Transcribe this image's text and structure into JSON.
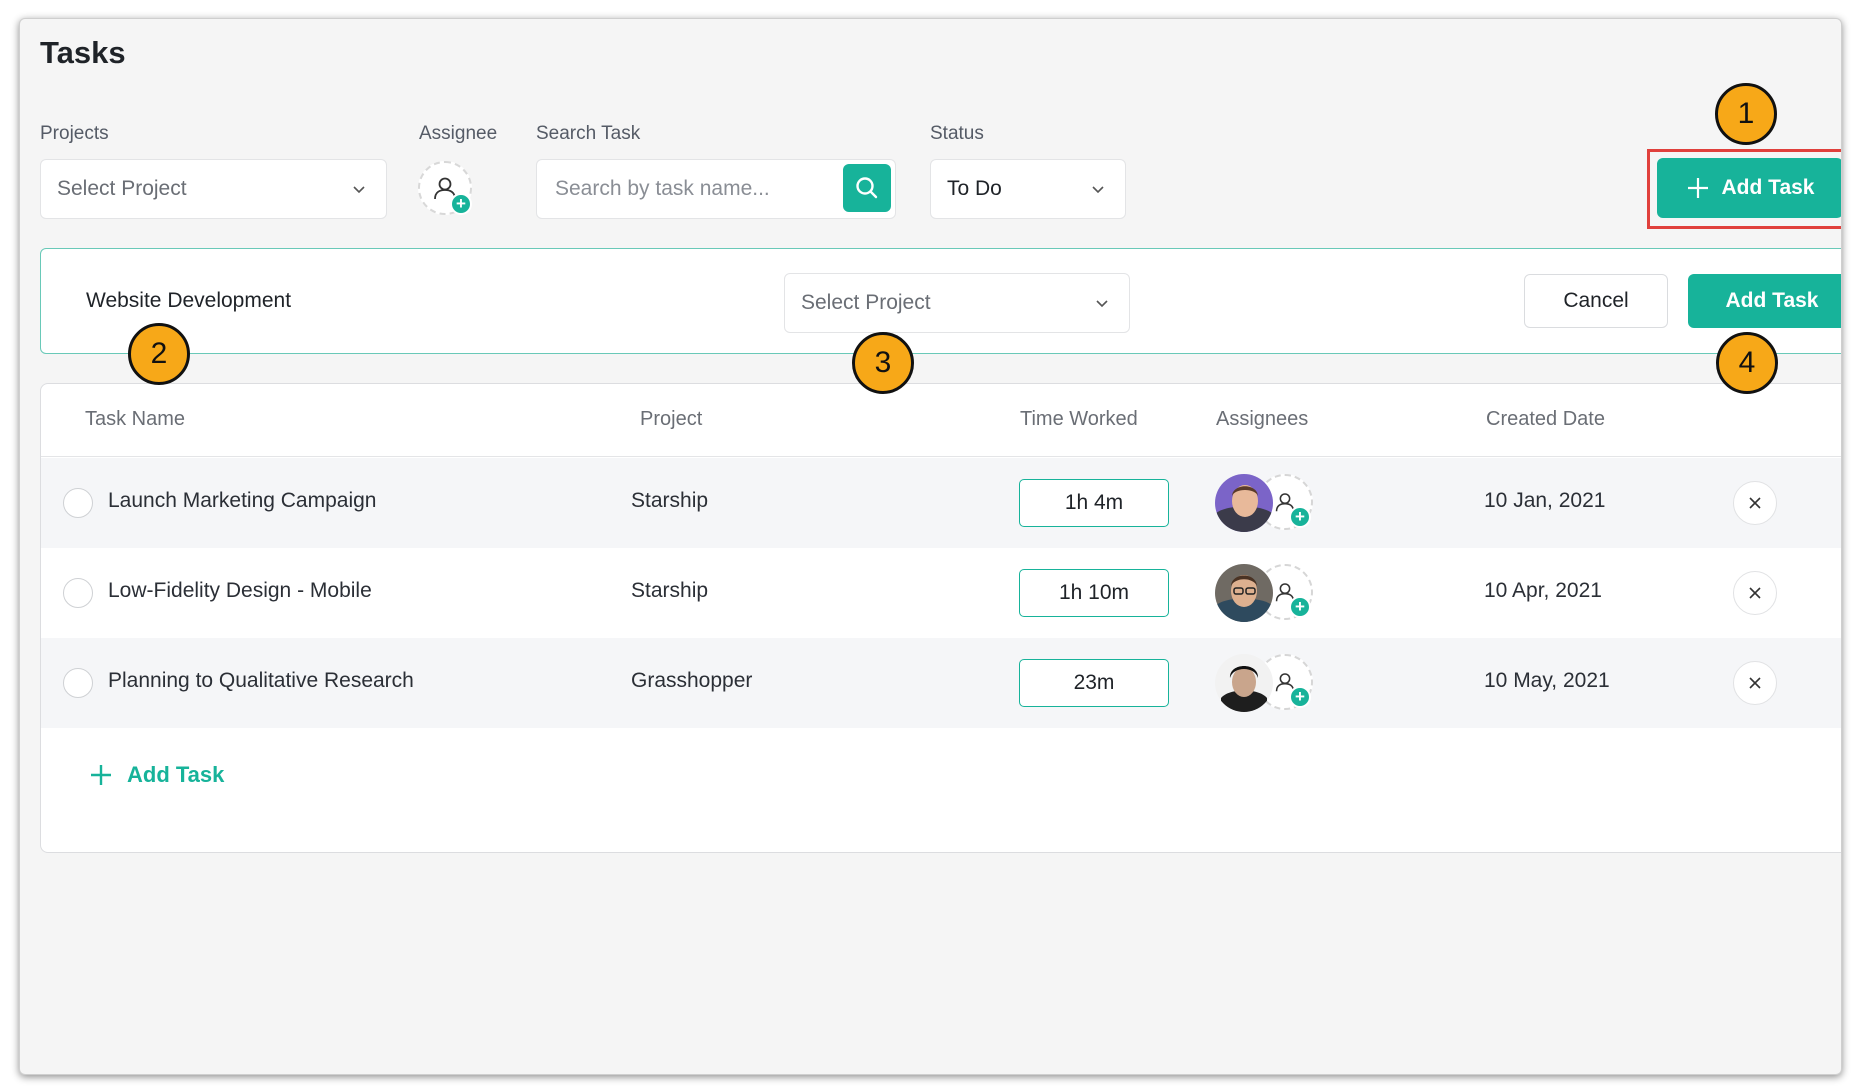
{
  "page": {
    "title": "Tasks"
  },
  "filters": {
    "projects_label": "Projects",
    "projects_placeholder": "Select Project",
    "assignee_label": "Assignee",
    "search_label": "Search Task",
    "search_placeholder": "Search by task name...",
    "status_label": "Status",
    "status_value": "To Do"
  },
  "header_actions": {
    "add_task_label": "Add Task"
  },
  "quick_add": {
    "task_name": "Website Development",
    "project_placeholder": "Select Project",
    "cancel_label": "Cancel",
    "add_label": "Add Task"
  },
  "callouts": [
    "1",
    "2",
    "3",
    "4"
  ],
  "table": {
    "headers": [
      "Task Name",
      "Project",
      "Time Worked",
      "Assignees",
      "Created Date"
    ],
    "rows": [
      {
        "task": "Launch Marketing Campaign",
        "project": "Starship",
        "time": "1h 4m",
        "date": "10 Jan, 2021"
      },
      {
        "task": "Low-Fidelity Design - Mobile",
        "project": "Starship",
        "time": "1h 10m",
        "date": "10 Apr, 2021"
      },
      {
        "task": "Planning to Qualitative Research",
        "project": "Grasshopper",
        "time": "23m",
        "date": "10 May, 2021"
      }
    ],
    "add_task_link": "Add Task"
  },
  "colors": {
    "accent": "#17b39a",
    "callout": "#f7a818",
    "highlight": "#e0403c"
  }
}
